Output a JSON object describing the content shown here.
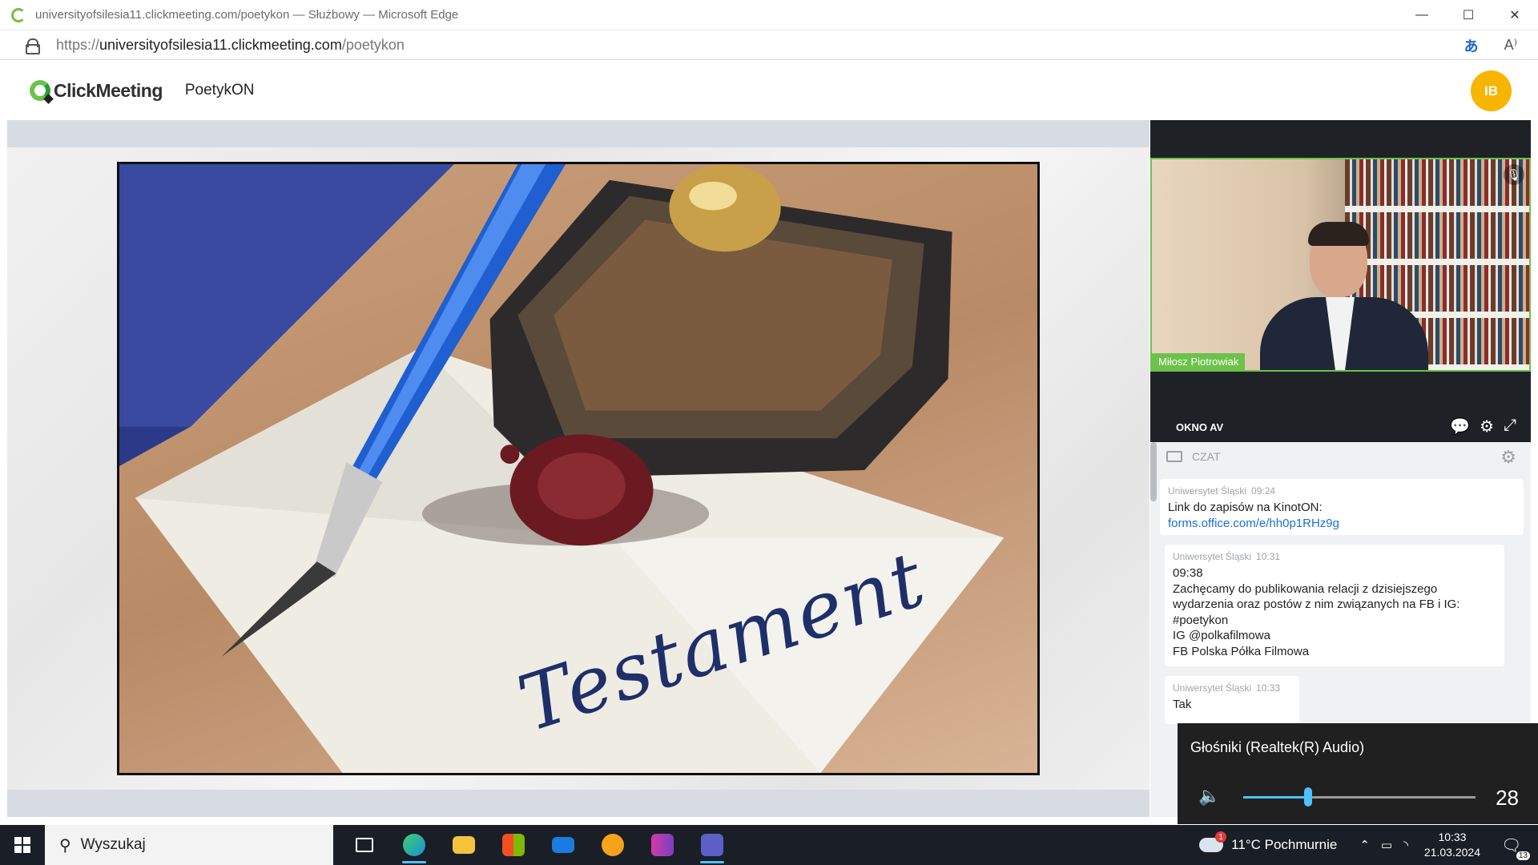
{
  "browser": {
    "title": "universityofsilesia11.clickmeeting.com/poetykon — Służbowy — Microsoft Edge",
    "url_scheme": "https://",
    "url_host": "universityofsilesia11.clickmeeting.com",
    "url_path": "/poetykon",
    "translate_glyph": "あ",
    "read_glyph": "A⁾",
    "min_glyph": "—",
    "max_glyph": "☐",
    "close_glyph": "✕"
  },
  "app": {
    "logo_text": "ClickMeeting",
    "room_name": "PoetykON",
    "avatar_initials": "IB",
    "avatar_color": "#f7b500",
    "accent_color": "#6cc24a"
  },
  "slide": {
    "word": "Testament"
  },
  "video": {
    "participant_name": "Miłosz Piotrowiak",
    "mic_glyph": "🎙"
  },
  "av_window": {
    "label": "OKNO AV",
    "icon_chat": "💬",
    "icon_settings": "⚙",
    "icon_expand": "⤢"
  },
  "chat": {
    "label": "CZAT",
    "gear_glyph": "⚙",
    "messages": [
      {
        "author": "Uniwersytet Śląski",
        "time": "09:24",
        "text": "Link do zapisów na KinotON:",
        "link": "forms.office.com/e/hh0p1RHz9g"
      },
      {
        "author": "Uniwersytet Śląski",
        "time": "10:31",
        "lines": [
          "09:38",
          "Zachęcamy do publikowania relacji z dzisiejszego",
          "wydarzenia oraz postów z nim związanych na FB i IG:",
          "#poetykon",
          "IG @polkafilmowa",
          "FB Polska Półka Filmowa"
        ]
      },
      {
        "author": "Uniwersytet Śląski",
        "time": "10:33",
        "text": "Tak"
      }
    ]
  },
  "volume": {
    "device": "Głośniki (Realtek(R) Audio)",
    "level": 28,
    "speaker_glyph": "🔈"
  },
  "taskbar": {
    "search_placeholder": "Wyszukaj",
    "search_glyph": "⚲",
    "weather_text": "11°C  Pochmurnie",
    "weather_badge": "1",
    "time": "10:33",
    "date": "21.03.2024",
    "notif_count": "13",
    "tray_chevron": "⌃",
    "tray_battery": "▭",
    "tray_wifi": "◝",
    "notif_glyph": "🗨"
  }
}
